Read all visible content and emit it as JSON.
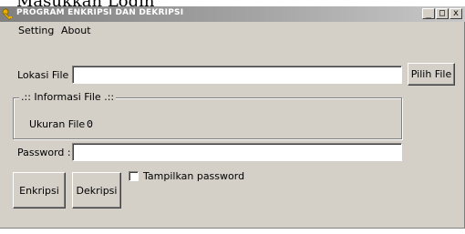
{
  "background_text": "Masukkan Login",
  "window": {
    "title": "PROGRAM ENKRIPSI DAN DEKRIPSI",
    "minimize_glyph": "_",
    "maximize_glyph": "□",
    "close_glyph": "x"
  },
  "menu": {
    "setting": "Setting",
    "about": "About"
  },
  "file": {
    "label": "Lokasi File :",
    "value": "",
    "browse_button": "Pilih File"
  },
  "info_group": {
    "legend": ".:: Informasi File .::",
    "size_label": "Ukuran File :",
    "size_value": "0"
  },
  "password": {
    "label": "Password :",
    "value": ""
  },
  "actions": {
    "encrypt_button": "Enkripsi",
    "decrypt_button": "Dekripsi",
    "show_password_label": "Tampilkan password",
    "show_password_checked": false
  },
  "colors": {
    "window_face": "#d4d0c8",
    "titlebar_inactive": "#808080"
  }
}
